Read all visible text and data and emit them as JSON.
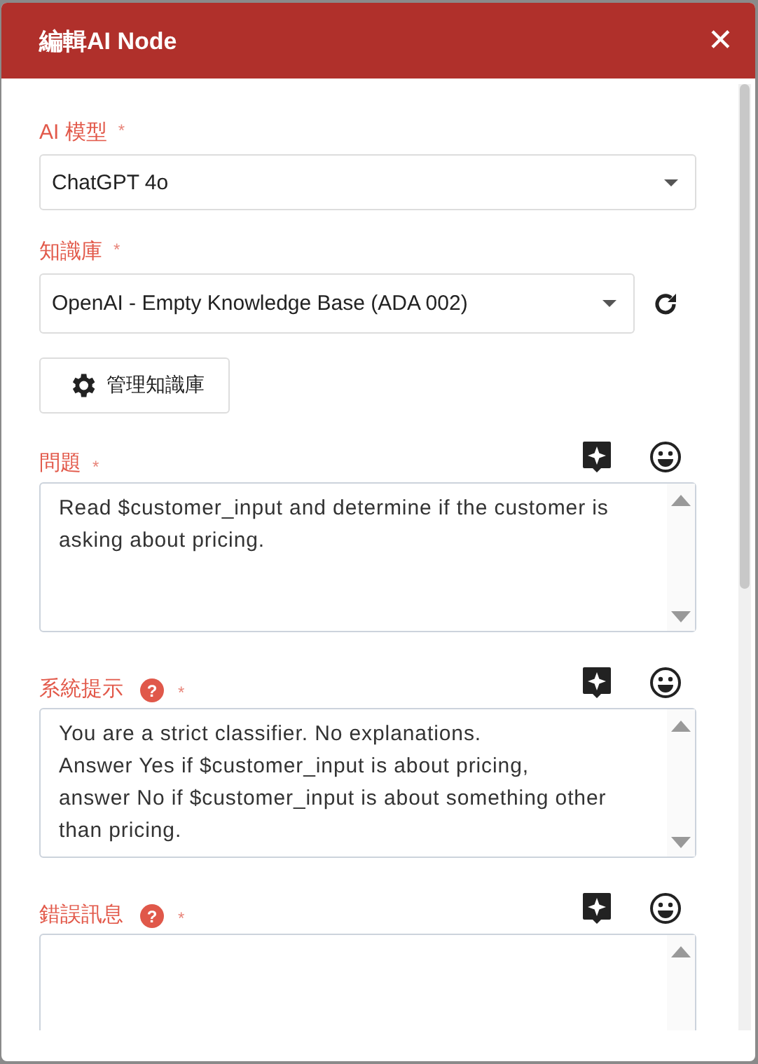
{
  "dialog": {
    "title": "編輯AI Node",
    "close": "✕"
  },
  "fields": [
    {
      "kind": "select",
      "label": "AI 模型",
      "required_mark": "*",
      "value": "ChatGPT 4o",
      "refresh": false
    },
    {
      "kind": "select",
      "label": "知識庫",
      "required_mark": "*",
      "value": "OpenAI - Empty Knowledge Base (ADA 002)",
      "refresh": true
    },
    {
      "kind": "button",
      "label": "管理知識庫"
    },
    {
      "kind": "textarea",
      "label": "問題",
      "required_mark": "*",
      "value": "Read $customer_input and determine if the customer is asking about pricing."
    },
    {
      "kind": "textarea",
      "label": "系統提示",
      "help": "?",
      "required_mark": "*",
      "value": "You are a strict classifier. No explanations.\nAnswer Yes if $customer_input is about pricing,\nanswer No if $customer_input is about something other than pricing."
    },
    {
      "kind": "textarea",
      "label": "錯誤訊息",
      "help": "?",
      "required_mark": "*"
    }
  ]
}
